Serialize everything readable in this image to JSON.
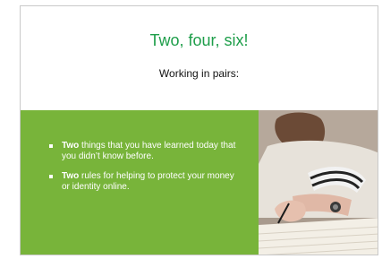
{
  "slide": {
    "title": "Two, four, six!",
    "subtitle": "Working in pairs:",
    "bullets": [
      {
        "bold": "Two",
        "text": " things that you have learned today that you didn’t know before."
      },
      {
        "bold": "Two",
        "text": " rules for helping to protect your money or identity online."
      }
    ],
    "image": {
      "icon": "photo-person-writing-in-notebook"
    }
  },
  "colors": {
    "title": "#1e9e4a",
    "panel": "#78b43a",
    "bullet_text": "#ffffff"
  }
}
